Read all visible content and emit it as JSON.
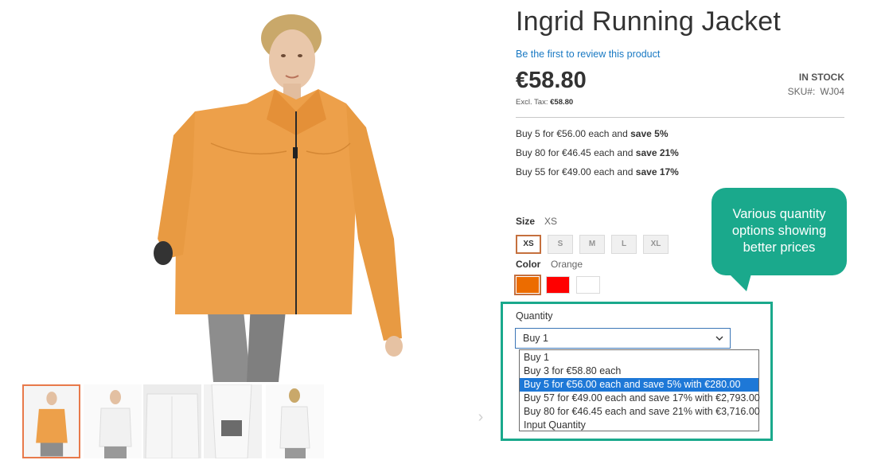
{
  "product": {
    "title": "Ingrid Running Jacket",
    "review_link": "Be the first to review this product",
    "price": "€58.80",
    "excl_tax_label": "Excl. Tax:",
    "excl_tax_value": "€58.80",
    "stock": "IN STOCK",
    "sku_label": "SKU#:",
    "sku_value": "WJ04"
  },
  "tier_prices": [
    {
      "prefix": "Buy 5 for €56.00 each and",
      "save": "save 5%"
    },
    {
      "prefix": "Buy 80 for €46.45 each and",
      "save": "save 21%"
    },
    {
      "prefix": "Buy 55 for €49.00 each and",
      "save": "save 17%"
    }
  ],
  "size": {
    "label": "Size",
    "selected": "XS",
    "options": [
      "XS",
      "S",
      "M",
      "L",
      "XL"
    ]
  },
  "color": {
    "label": "Color",
    "selected": "Orange",
    "swatches": [
      {
        "name": "Orange",
        "hex": "#ec6c00"
      },
      {
        "name": "Red",
        "hex": "#ff0000"
      },
      {
        "name": "White",
        "hex": "#ffffff"
      }
    ]
  },
  "quantity": {
    "label": "Quantity",
    "selected": "Buy 1",
    "options": [
      "Buy 1",
      "Buy 3 for €58.80 each",
      "Buy 5 for €56.00 each and save 5% with €280.00",
      "Buy 57 for €49.00 each and save 17% with €2,793.00",
      "Buy 80 for €46.45 each and save 21% with €3,716.00",
      "Input Quantity"
    ],
    "highlighted_index": 2
  },
  "callout": {
    "line1": "Various quantity",
    "line2": "options showing",
    "line3": "better prices"
  },
  "colors": {
    "accent": "#1aa98c",
    "link": "#1979c3",
    "select_highlight": "#1e78d7",
    "selected_border": "#c5703e",
    "jacket": "#eda04a"
  },
  "gallery": {
    "thumbnails": [
      "orange-jacket-front",
      "white-jacket-front",
      "white-jacket-back",
      "cuff-detail",
      "white-jacket-side"
    ],
    "next_icon": "chevron-right-icon"
  }
}
